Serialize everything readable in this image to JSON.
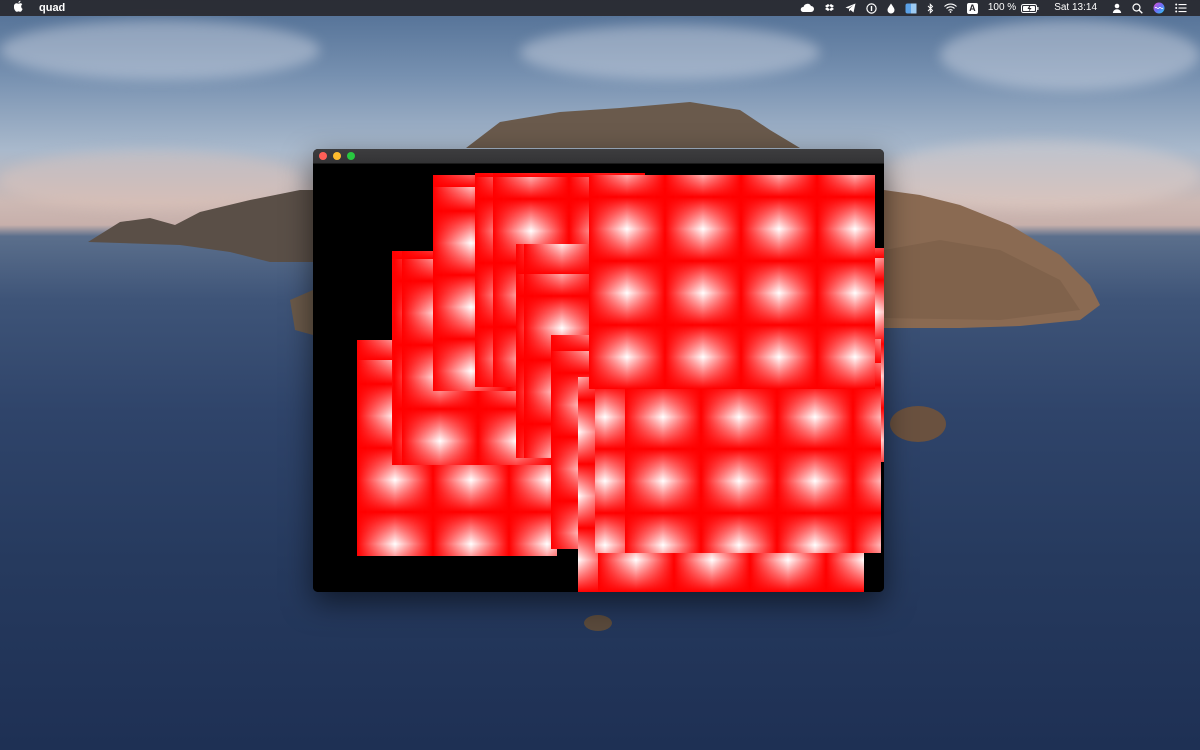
{
  "menubar": {
    "apple_icon": "apple-logo-icon",
    "app_name": "quad",
    "battery_percent": "100 %",
    "clock": "Sat 13:14",
    "input_source": "A",
    "status_icons": [
      "cloud-icon",
      "dropbox-icon",
      "telegram-icon",
      "onepassword-icon",
      "drop-icon",
      "finder-icon",
      "bluetooth-icon",
      "wifi-icon",
      "input-source-icon",
      "battery-icon",
      "user-icon",
      "search-icon",
      "siri-icon",
      "control-center-icon"
    ]
  },
  "window": {
    "title": "",
    "background": "#000000",
    "quad_colors": [
      "#ff0000",
      "#ffffff"
    ]
  },
  "colors": {
    "menubar": "#28282e",
    "close": "#fe5f57",
    "minimize": "#febc2e",
    "zoom": "#28c840"
  }
}
